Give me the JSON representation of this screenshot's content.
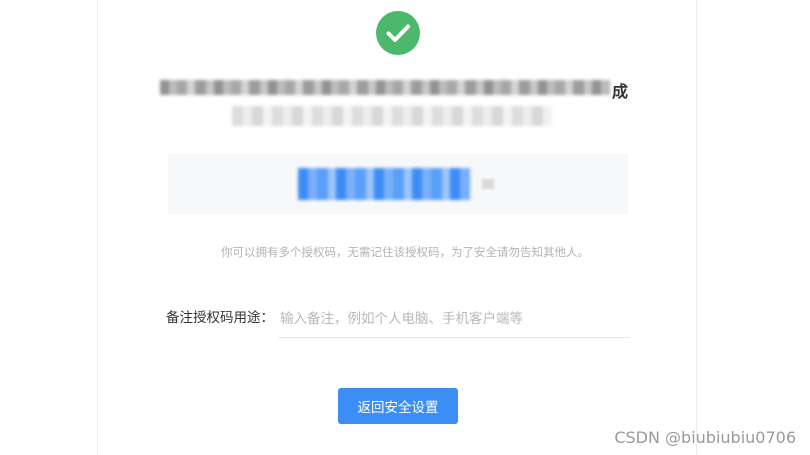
{
  "success": {
    "icon": "check-circle-icon",
    "color": "#4cb86b",
    "title_visible_suffix": "成"
  },
  "hint": {
    "text": "你可以拥有多个授权码，无需记住该授权码，为了安全请勿告知其他人。"
  },
  "form": {
    "label": "备注授权码用途：",
    "placeholder": "输入备注，例如个人电脑、手机客户端等",
    "value": ""
  },
  "actions": {
    "back_label": "返回安全设置"
  },
  "watermark": {
    "text": "CSDN @biubiubiu0706"
  },
  "colors": {
    "primary": "#3a8ef6",
    "success": "#4cb86b",
    "hint_text": "#b3b3b3",
    "code_box_bg": "#f7f8fa"
  }
}
